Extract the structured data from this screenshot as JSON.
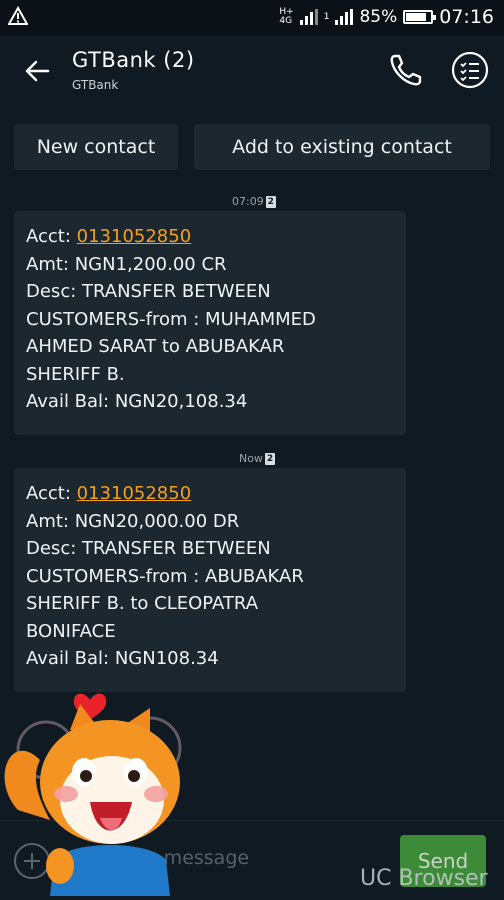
{
  "status_bar": {
    "network_label": "H+",
    "network_label2": "4G",
    "sim_number": "1",
    "battery": "85%",
    "battery_level": 0.85,
    "time": "07:16",
    "warning_icon": "warning-icon"
  },
  "header": {
    "title": "GTBank (2)",
    "subtitle": "GTBank",
    "back_icon": "arrow-left-icon",
    "call_icon": "phone-icon",
    "menu_icon": "checklist-menu-icon"
  },
  "actions": {
    "new_contact": "New contact",
    "add_existing": "Add to existing contact"
  },
  "messages": [
    {
      "timestamp": "07:09",
      "sim": "2",
      "acct_label": "Acct: ",
      "acct": "0131052850",
      "lines": [
        "Amt: NGN1,200.00 CR",
        "Desc: TRANSFER BETWEEN",
        "CUSTOMERS-from : MUHAMMED",
        "AHMED SARAT to ABUBAKAR",
        "SHERIFF B.",
        "Avail Bal: NGN20,108.34"
      ]
    },
    {
      "timestamp": "Now",
      "sim": "2",
      "acct_label": "Acct: ",
      "acct": "0131052850",
      "lines": [
        "Amt: NGN20,000.00 DR",
        "Desc: TRANSFER BETWEEN",
        "CUSTOMERS-from : ABUBAKAR",
        "SHERIFF B. to CLEOPATRA",
        "BONIFACE",
        "Avail Bal: NGN108.34"
      ]
    }
  ],
  "compose": {
    "placeholder": "Type message",
    "send": "Send",
    "add_icon": "plus-icon"
  },
  "overlay": {
    "watermark": "UC Browser",
    "mascot": "uc-squirrel-mascot"
  },
  "colors": {
    "background": "#0f1a22",
    "bubble": "#1c272f",
    "link": "#f4a01c",
    "send": "#3d8a38"
  }
}
